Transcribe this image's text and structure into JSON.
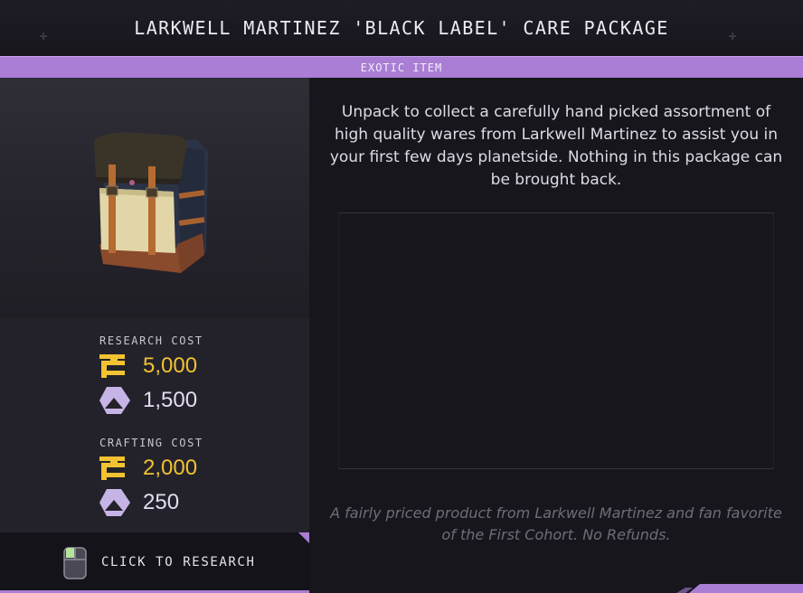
{
  "header": {
    "title": "LARKWELL MARTINEZ 'BLACK LABEL' CARE PACKAGE"
  },
  "rarity": {
    "label": "EXOTIC ITEM",
    "color": "#a97ed4"
  },
  "item": {
    "icon": "backpack-care-package"
  },
  "research_cost": {
    "label": "RESEARCH COST",
    "credits": "5,000",
    "data": "1,500"
  },
  "crafting_cost": {
    "label": "CRAFTING COST",
    "credits": "2,000",
    "data": "250"
  },
  "currencies": {
    "credits_icon": "credits-icon",
    "credits_color": "#f1c232",
    "data_icon": "hexagon-data-icon",
    "data_color": "#c6b4e6"
  },
  "action": {
    "label": "CLICK TO RESEARCH",
    "icon": "mouse-left-click-icon"
  },
  "description": "Unpack to collect a carefully hand picked assortment of high quality wares from Larkwell Martinez to assist you in your first few days planetside. Nothing in this package can be brought back.",
  "flavor": "A fairly priced product from Larkwell Martinez and fan favorite of the First Cohort. No Refunds."
}
